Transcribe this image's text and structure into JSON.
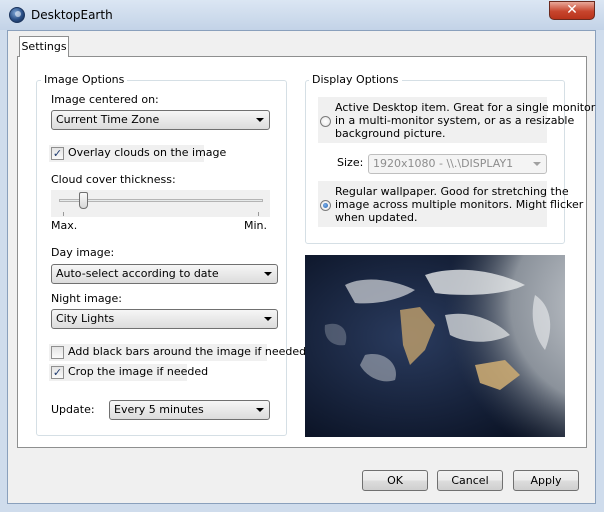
{
  "window": {
    "title": "DesktopEarth"
  },
  "tabs": [
    {
      "label": "Settings",
      "selected": true
    }
  ],
  "image_options": {
    "legend": "Image Options",
    "centered_label": "Image centered on:",
    "centered_value": "Current Time Zone",
    "overlay_clouds_label": "Overlay clouds on the image",
    "overlay_clouds_checked": true,
    "cloud_thickness_label": "Cloud cover thickness:",
    "cloud_thickness_fraction": 0.1,
    "slider_min_label": "Max.",
    "slider_max_label": "Min.",
    "day_image_label": "Day image:",
    "day_image_value": "Auto-select according to date",
    "night_image_label": "Night image:",
    "night_image_value": "City Lights",
    "black_bars_label": "Add black bars around the image if needed",
    "black_bars_checked": false,
    "crop_label": "Crop the image if needed",
    "crop_checked": true,
    "update_label": "Update:",
    "update_value": "Every 5 minutes"
  },
  "display_options": {
    "legend": "Display Options",
    "active_desktop_text": [
      "Active Desktop item. Great for a single monitor",
      "in a multi-monitor system, or as a resizable",
      "background picture."
    ],
    "active_desktop_selected": false,
    "size_label": "Size:",
    "size_value": "1920x1080 - \\\\.\\DISPLAY1",
    "wallpaper_text": [
      "Regular wallpaper. Good for stretching the",
      "image across multiple monitors. Might flicker",
      "when updated."
    ],
    "wallpaper_selected": true
  },
  "buttons": {
    "ok": "OK",
    "cancel": "Cancel",
    "apply": "Apply"
  },
  "icons": {
    "app": "globe-icon",
    "close": "close-icon",
    "check": "check-icon",
    "dropdown": "chevron-down-icon"
  }
}
